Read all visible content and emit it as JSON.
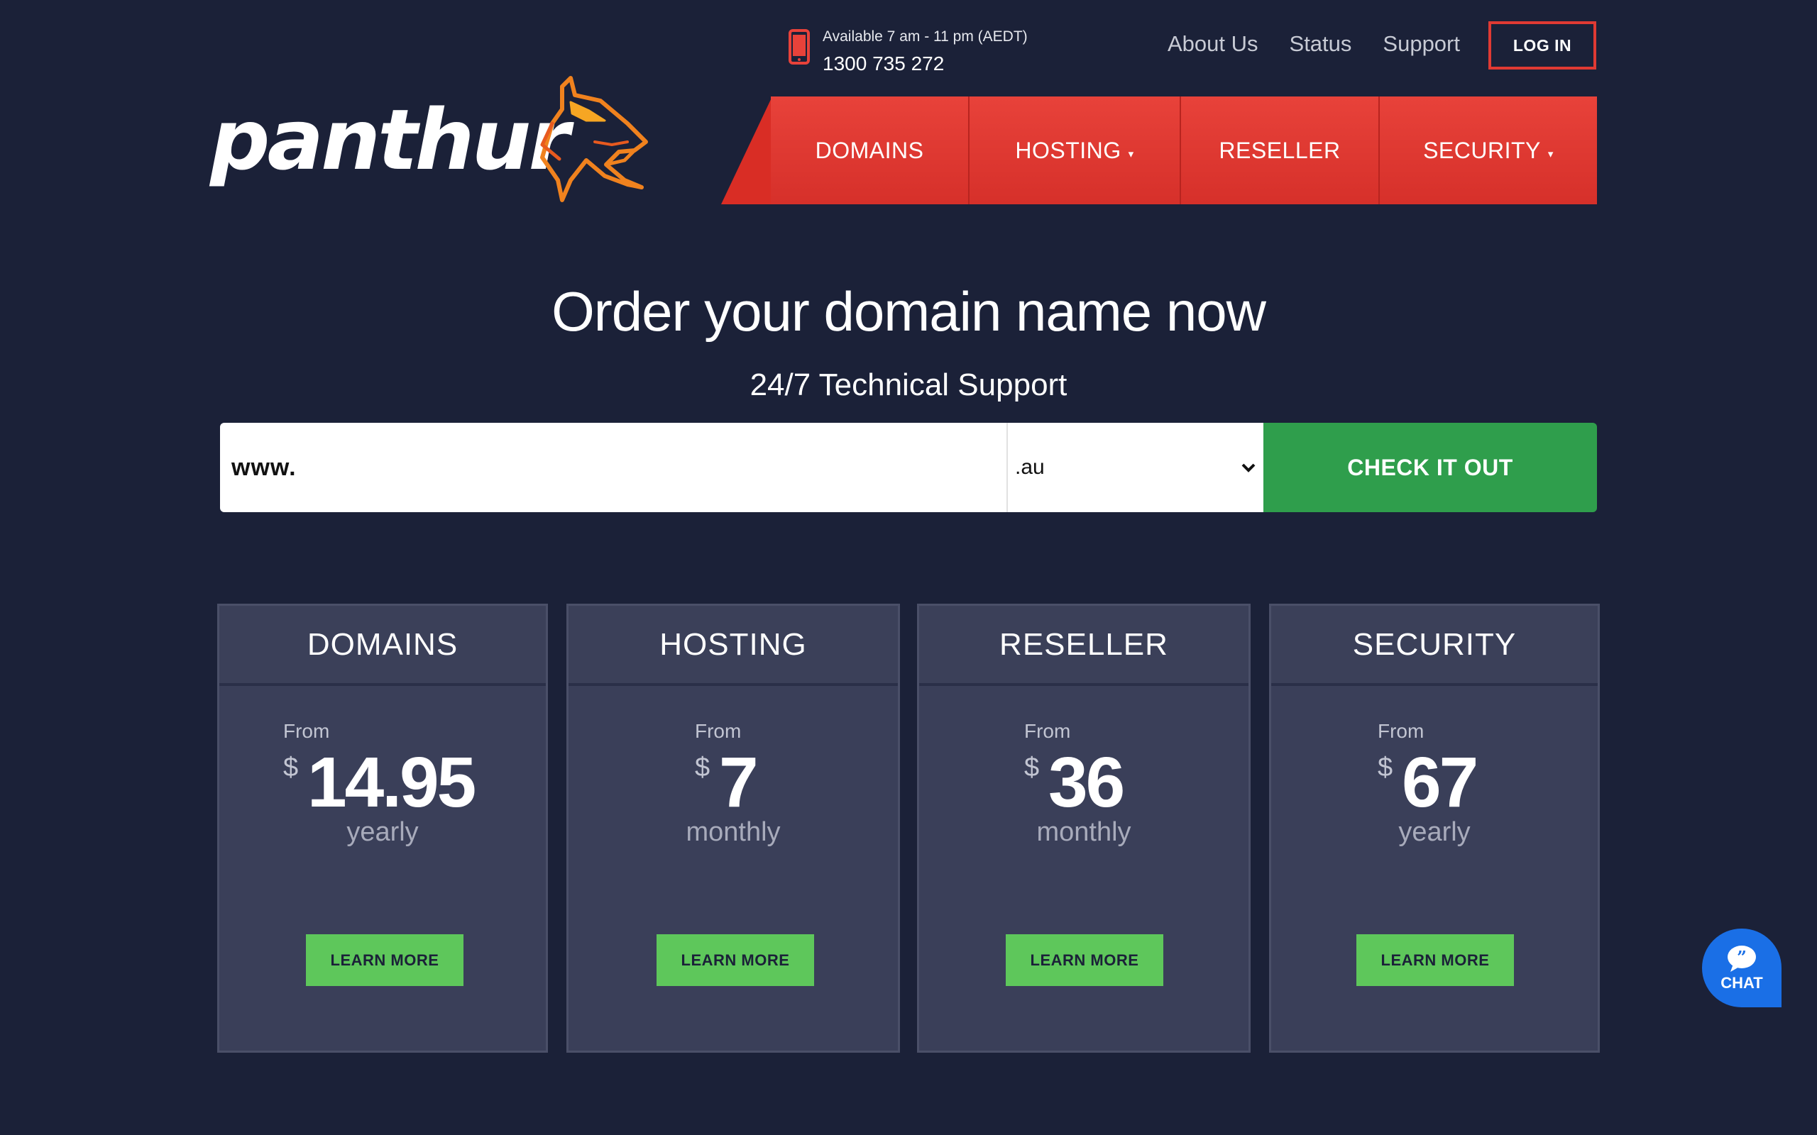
{
  "brand": {
    "logo_text": "panthur",
    "accent": "#e8423a",
    "cta_green": "#2f9e4c"
  },
  "contact": {
    "availability": "Available 7 am - 11 pm (AEDT)",
    "phone": "1300 735 272",
    "icon": "mobile-phone-icon"
  },
  "top_links": [
    "About Us",
    "Status",
    "Support"
  ],
  "login_label": "LOG IN",
  "nav": [
    {
      "label": "DOMAINS",
      "has_dropdown": false
    },
    {
      "label": "HOSTING",
      "has_dropdown": true
    },
    {
      "label": "RESELLER",
      "has_dropdown": false
    },
    {
      "label": "SECURITY",
      "has_dropdown": true
    }
  ],
  "caret": "▾",
  "hero": {
    "title": "Order your domain name now",
    "subtitle": "24/7 Technical Support"
  },
  "search": {
    "prefix": "www.",
    "tld_selected": ".au",
    "button": "CHECK IT OUT"
  },
  "cards": [
    {
      "title": "DOMAINS",
      "from": "From",
      "currency": "$",
      "price": "14.95",
      "period": "yearly",
      "button": "LEARN MORE"
    },
    {
      "title": "HOSTING",
      "from": "From",
      "currency": "$",
      "price": "7",
      "period": "monthly",
      "button": "LEARN MORE"
    },
    {
      "title": "RESELLER",
      "from": "From",
      "currency": "$",
      "price": "36",
      "period": "monthly",
      "button": "LEARN MORE"
    },
    {
      "title": "SECURITY",
      "from": "From",
      "currency": "$",
      "price": "67",
      "period": "yearly",
      "button": "LEARN MORE"
    }
  ],
  "chat": {
    "label": "CHAT",
    "icon": "chat-bubble-icon"
  }
}
